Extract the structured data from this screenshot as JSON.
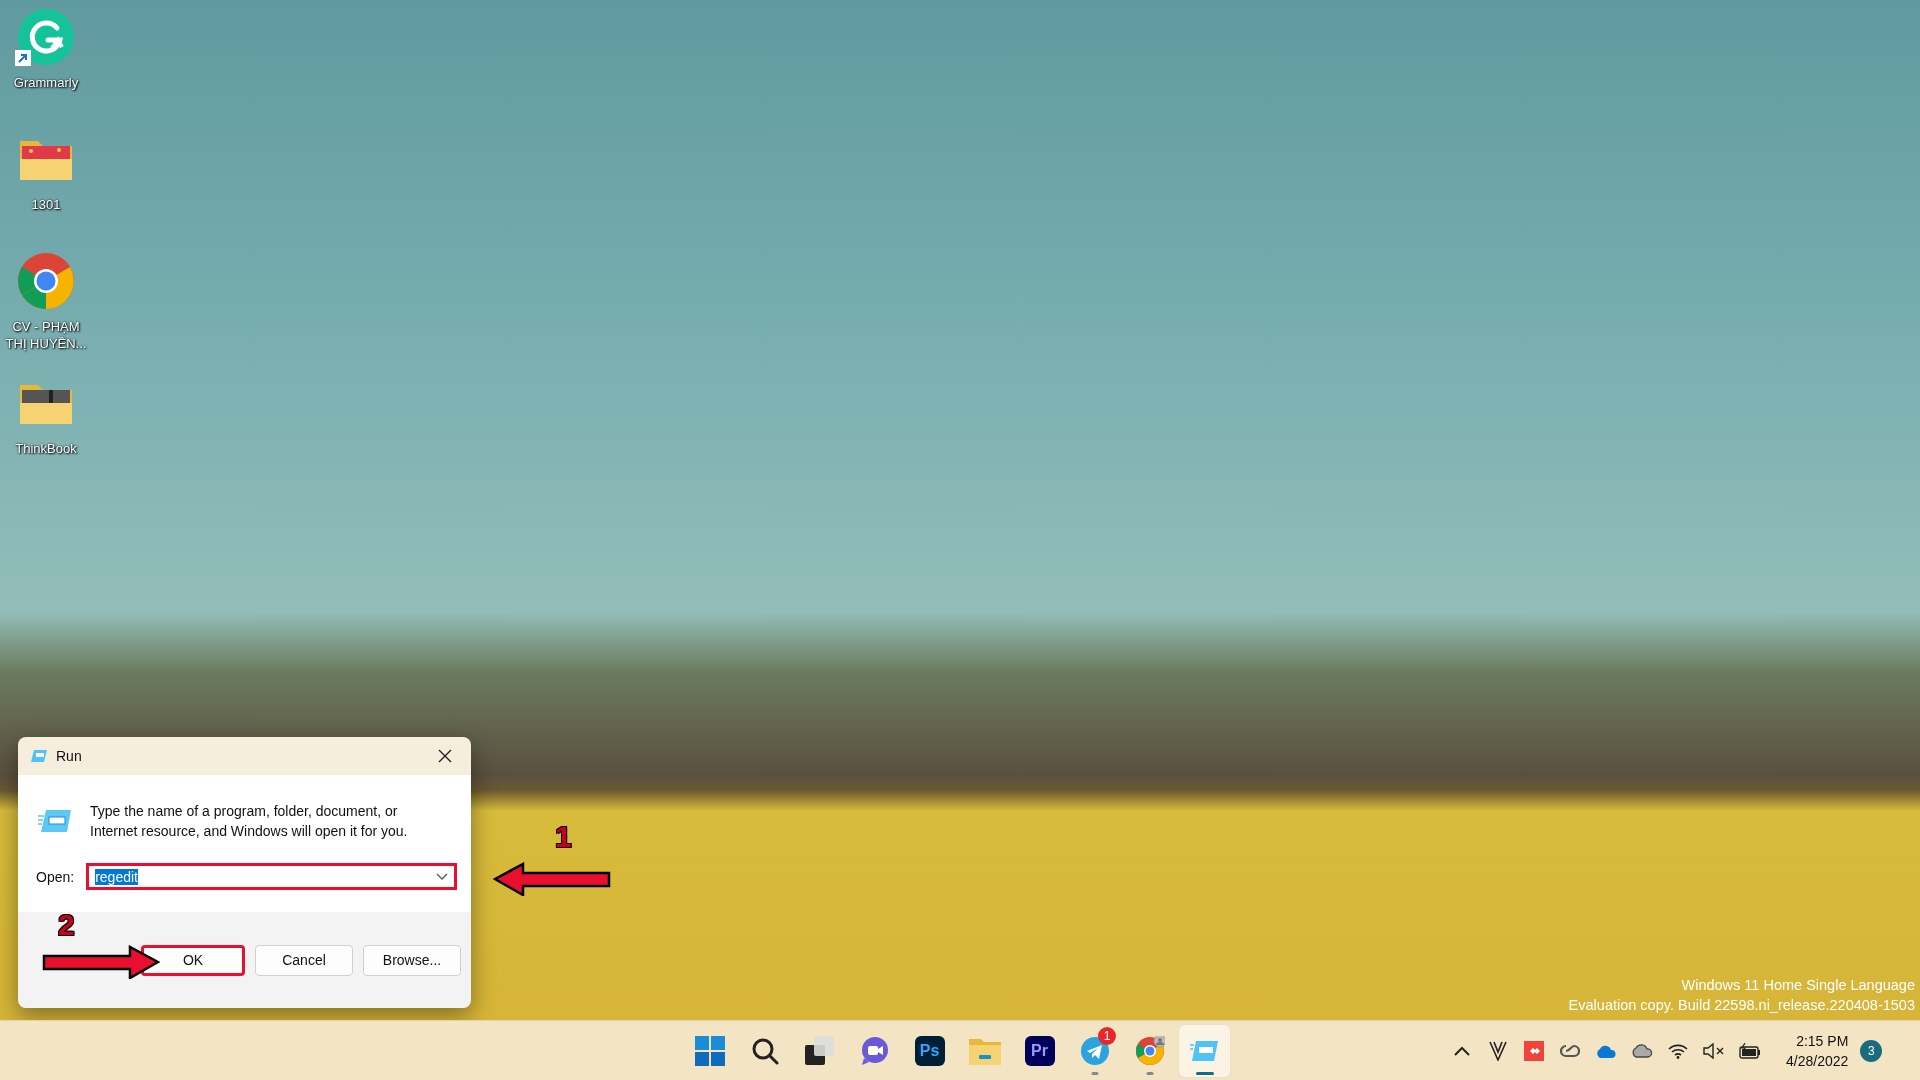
{
  "desktop_icons": [
    {
      "label": "Grammarly",
      "kind": "grammarly",
      "shortcut": true
    },
    {
      "label": "1301",
      "kind": "photo-folder",
      "shortcut": false
    },
    {
      "label": "CV - PHẠM THỊ HUYỀN...",
      "kind": "chrome",
      "shortcut": false
    },
    {
      "label": "ThinkBook",
      "kind": "dark-folder",
      "shortcut": false
    }
  ],
  "run_dialog": {
    "title": "Run",
    "message": "Type the name of a program, folder, document, or Internet resource, and Windows will open it for you.",
    "open_label": "Open:",
    "value": "regedit",
    "value_selected": true,
    "field_highlighted": true,
    "buttons": [
      {
        "label": "OK",
        "default": true,
        "highlighted": true
      },
      {
        "label": "Cancel",
        "default": false,
        "highlighted": false
      },
      {
        "label": "Browse...",
        "default": false,
        "highlighted": false
      }
    ]
  },
  "annotations": [
    {
      "label": "1",
      "kind": "left"
    },
    {
      "label": "2",
      "kind": "right"
    }
  ],
  "system_watermark": [
    "Windows 11 Home Single Language",
    "Evaluation copy. Build 22598.ni_release.220408-1503"
  ],
  "taskbar": {
    "apps": [
      {
        "kind": "start",
        "running": false,
        "selected": false
      },
      {
        "kind": "search",
        "running": false,
        "selected": false
      },
      {
        "kind": "taskview",
        "running": false,
        "selected": false
      },
      {
        "kind": "chat",
        "running": false,
        "selected": false
      },
      {
        "kind": "ps",
        "text": "Ps",
        "running": false,
        "selected": false
      },
      {
        "kind": "explorer",
        "running": false,
        "selected": false
      },
      {
        "kind": "pr",
        "text": "Pr",
        "running": false,
        "selected": false
      },
      {
        "kind": "telegram",
        "badge": "1",
        "running": true,
        "selected": false
      },
      {
        "kind": "chrome",
        "running": true,
        "selected": false
      },
      {
        "kind": "run",
        "running": true,
        "selected": true
      }
    ],
    "tray": [
      {
        "kind": "chevron"
      },
      {
        "kind": "v"
      },
      {
        "kind": "anydesk"
      },
      {
        "kind": "creative-cloud"
      },
      {
        "kind": "onedrive"
      },
      {
        "kind": "cloud"
      },
      {
        "kind": "wifi"
      },
      {
        "kind": "mute"
      },
      {
        "kind": "battery"
      }
    ],
    "time": "2:15 PM",
    "date": "4/28/2022",
    "notifications": "3"
  }
}
